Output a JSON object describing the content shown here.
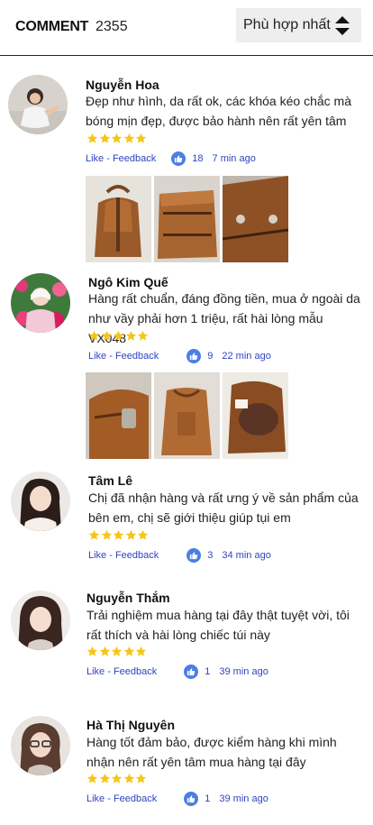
{
  "header": {
    "title": "COMMENT",
    "count": "2355",
    "sort_label": "Phù hợp nhất",
    "sort_icon": "sort-updown-icon"
  },
  "colors": {
    "link": "#2f44c2",
    "star": "#f5c518",
    "like_badge": "#4a7fe3",
    "sort_bg": "#eeeeee"
  },
  "comments": [
    {
      "name": "Nguyễn Hoa",
      "text": "Đẹp như hình, da rất ok, các khóa kéo chắc mà bóng mịn đẹp, được bảo hành nên rất yên tâm",
      "rating": 5,
      "like_label": "Like - Feedback",
      "likes": "18",
      "time": "7 min ago",
      "photos": [
        "leather-backpack-photo",
        "leather-backpack-zipper-photo",
        "leather-backpack-detail-photo"
      ]
    },
    {
      "name": "Ngô Kim Quế",
      "text": "Hàng rất chuẩn, đáng đồng tiền, mua ở ngoài da như vầy phải hơn 1 triệu, rất hài lòng mẫu VX048",
      "rating": 5,
      "like_label": "Like - Feedback",
      "likes": "9",
      "time": "22 min ago",
      "photos": [
        "leather-bag-clasp-photo",
        "leather-bag-drawstring-photo",
        "leather-bag-interior-photo"
      ]
    },
    {
      "name": "Tâm Lê",
      "text": "Chị đã nhận hàng và rất ưng ý về sản phẩm của bên em, chị sẽ giới thiệu giúp tụi em",
      "rating": 5,
      "like_label": "Like - Feedback",
      "likes": "3",
      "time": "34 min ago"
    },
    {
      "name": "Nguyễn Thắm",
      "text": "Trải nghiệm mua hàng tại đây thật tuyệt vời, tôi rất thích và hài lòng chiếc túi này",
      "rating": 5,
      "like_label": "Like - Feedback",
      "likes": "1",
      "time": "39 min ago"
    },
    {
      "name": "Hà Thị Nguyên",
      "text": "Hàng tốt đảm bảo, được kiểm hàng khi mình nhận nên rất yên tâm mua hàng tại đây",
      "rating": 5,
      "like_label": "Like - Feedback",
      "likes": "1",
      "time": "39 min ago"
    }
  ]
}
